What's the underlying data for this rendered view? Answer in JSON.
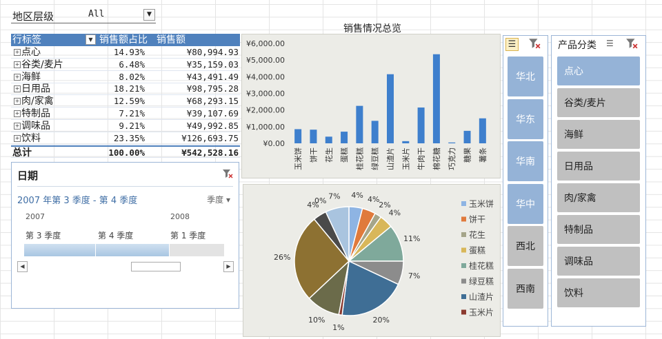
{
  "report_filter": {
    "label": "地区层级",
    "value": "All"
  },
  "pivot": {
    "headers": [
      "行标签",
      "销售额占比",
      "销售额"
    ],
    "rows": [
      {
        "cat": "点心",
        "pct": "14.93%",
        "amt": "¥80,994.93"
      },
      {
        "cat": "谷类/麦片",
        "pct": "6.48%",
        "amt": "¥35,159.03"
      },
      {
        "cat": "海鲜",
        "pct": "8.02%",
        "amt": "¥43,491.49"
      },
      {
        "cat": "日用品",
        "pct": "18.21%",
        "amt": "¥98,795.28"
      },
      {
        "cat": "肉/家禽",
        "pct": "12.59%",
        "amt": "¥68,293.15"
      },
      {
        "cat": "特制品",
        "pct": "7.21%",
        "amt": "¥39,107.69"
      },
      {
        "cat": "调味品",
        "pct": "9.21%",
        "amt": "¥49,992.85"
      },
      {
        "cat": "饮料",
        "pct": "23.35%",
        "amt": "¥126,693.75"
      }
    ],
    "total": {
      "cat": "总计",
      "pct": "100.00%",
      "amt": "¥542,528.16"
    }
  },
  "timeline": {
    "title": "日期",
    "range": "2007 年第 3 季度 - 第 4 季度",
    "level": "季度",
    "years": [
      "2007",
      "2008"
    ],
    "quarters": [
      "第 3 季度",
      "第 4 季度",
      "第 1 季度"
    ]
  },
  "chart_data": [
    {
      "type": "bar",
      "title": "销售情况总览",
      "categories": [
        "玉米饼",
        "饼干",
        "花生",
        "蛋糕",
        "桂花糕",
        "绿豆糕",
        "山渣片",
        "玉米片",
        "牛肉干",
        "棉花糖",
        "巧克力",
        "糖果",
        "薯条"
      ],
      "values": [
        850,
        820,
        400,
        700,
        2250,
        1350,
        4150,
        130,
        2150,
        5350,
        50,
        750,
        1500
      ],
      "ylim": [
        0,
        6000
      ],
      "yticks": [
        "¥0.00",
        "¥1,000.00",
        "¥2,000.00",
        "¥3,000.00",
        "¥4,000.00",
        "¥5,000.00",
        "¥6,000.00"
      ],
      "color": "#3e7fcd"
    },
    {
      "type": "pie",
      "slice_values": [
        4,
        4,
        2,
        4,
        11,
        7,
        20,
        1,
        10,
        26,
        4,
        0,
        7
      ],
      "slice_labels": [
        "4%",
        "4%",
        "2%",
        "4%",
        "11%",
        "7%",
        "20%",
        "1%",
        "10%",
        "26%",
        "4%",
        "0%",
        "7%"
      ],
      "colors": [
        "#8eb4e3",
        "#e07a3c",
        "#a5a58a",
        "#d8b75a",
        "#7fa99b",
        "#8c8c8c",
        "#3f6e95",
        "#8b3a2f",
        "#6b6b4a",
        "#8d7132",
        "#4a4a4a",
        "#c0c0c0",
        "#a9c4df"
      ],
      "legend": [
        "玉米饼",
        "饼干",
        "花生",
        "蛋糕",
        "桂花糕",
        "绿豆糕",
        "山渣片",
        "玉米片"
      ]
    }
  ],
  "slicer_region": {
    "items": [
      {
        "label": "华北",
        "selected": true
      },
      {
        "label": "华东",
        "selected": true
      },
      {
        "label": "华南",
        "selected": true
      },
      {
        "label": "华中",
        "selected": true
      },
      {
        "label": "西北",
        "selected": false
      },
      {
        "label": "西南",
        "selected": false
      }
    ]
  },
  "slicer_category": {
    "title": "产品分类",
    "items": [
      {
        "label": "点心",
        "selected": true
      },
      {
        "label": "谷类/麦片",
        "selected": false
      },
      {
        "label": "海鲜",
        "selected": false
      },
      {
        "label": "日用品",
        "selected": false
      },
      {
        "label": "肉/家禽",
        "selected": false
      },
      {
        "label": "特制品",
        "selected": false
      },
      {
        "label": "调味品",
        "selected": false
      },
      {
        "label": "饮料",
        "selected": false
      }
    ]
  }
}
